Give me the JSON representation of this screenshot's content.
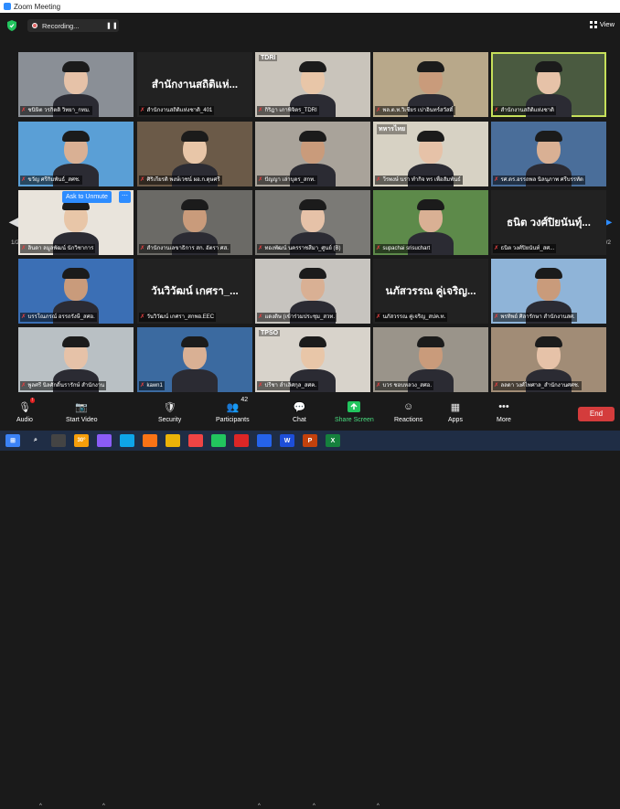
{
  "window": {
    "title": "Zoom Meeting"
  },
  "topbar": {
    "recording_label": "Recording...",
    "pause_glyph": "❚❚",
    "view_label": "View"
  },
  "tiles": [
    {
      "label": "ชนิษิต วรกิตติ วิทยา_กทม.",
      "name_only": false
    },
    {
      "label": "สำนักงานสถิติแห่งชาติ_401",
      "name_only": true,
      "big": "สำนักงานสถิติแห่..."
    },
    {
      "label": "กิริฎา เภาพิจิตร_TDRI",
      "name_only": false,
      "logo": "TDRI"
    },
    {
      "label": "พล.ต.ท.วิเชียร เปาอินทร์สวัสดิ์",
      "name_only": false
    },
    {
      "label": "สำนักงานสถิติแห่งชาติ",
      "name_only": false,
      "active": true
    },
    {
      "label": "ขวัญ ศรีกิมพันธ์_สศช.",
      "name_only": false
    },
    {
      "label": "ศิริเกียรติ พงษ์เวชน์ ผอ.ก.ดุษศรี",
      "name_only": false
    },
    {
      "label": "ปัญญา เล่าบุตร_สกท.",
      "name_only": false
    },
    {
      "label": "วีรพงษ์ นรา ทำกิจ ทร เพื่อสัมพันธ์",
      "name_only": false,
      "logo": "ทหารไทย"
    },
    {
      "label": "รศ.ดร.อรรถพล นิลนุภาพ ศรีบรรทัด",
      "name_only": false
    },
    {
      "label": "ลินดา ลมูลพัฒน์ นักวิชาการ",
      "name_only": false,
      "ask": true
    },
    {
      "label": "สำนักงานเลขาธิการ สก. อัตรา ศส.",
      "name_only": false
    },
    {
      "label": "ทองพัฒน์ นครราชสีมา_ศูนย์ (B)",
      "name_only": false
    },
    {
      "label": "supachai srisuchart",
      "name_only": false
    },
    {
      "label": "ธนิต วงศ์ปิยนันท์_สศ...",
      "name_only": true,
      "big": "ธนิต วงศ์ปิยนันท์ุ..."
    },
    {
      "label": "บรรโณภรณ์ อรรถรังษี_สศอ.",
      "name_only": false
    },
    {
      "label": "วันวิวัฒน์ เกศรา_สกพอ.EEC",
      "name_only": true,
      "big": "วันวิวัฒน์ เกศรา_..."
    },
    {
      "label": "แดงดิษ (เข้าร่วมประชุม_สวท.",
      "name_only": false
    },
    {
      "label": "นภัสวรรณ คู่เจริญ_สปค.ท.",
      "name_only": true,
      "big": "นภัสวรรณ คู่เจริญ..."
    },
    {
      "label": "พรทิพย์ ศิลารักษา สำนักงานสศ.",
      "name_only": false
    },
    {
      "label": "พูลศรี นิลศักดิ์นรารักษ์ สำนักงาน",
      "name_only": false
    },
    {
      "label": "kawn1",
      "name_only": false
    },
    {
      "label": "ปรีชา ล่ำเลิศกุล_สศค.",
      "name_only": false,
      "logo": "TPSO"
    },
    {
      "label": "บวร ชอบหลวง_สศอ.",
      "name_only": false
    },
    {
      "label": "ลลดา วงศ์ไพศาล_สำนักงานศศช.",
      "name_only": false
    }
  ],
  "pagination": {
    "left": "1/2",
    "right": "1/2"
  },
  "ask_button": {
    "label": "Ask to Unmute",
    "more": "⋯"
  },
  "toolbar": {
    "audio": "Audio",
    "video": "Start Video",
    "security": "Security",
    "participants": "Participants",
    "participants_count": "42",
    "chat": "Chat",
    "share": "Share Screen",
    "reactions": "Reactions",
    "apps": "Apps",
    "more": "More",
    "end": "End"
  },
  "taskbar": {
    "weather": "30°"
  }
}
